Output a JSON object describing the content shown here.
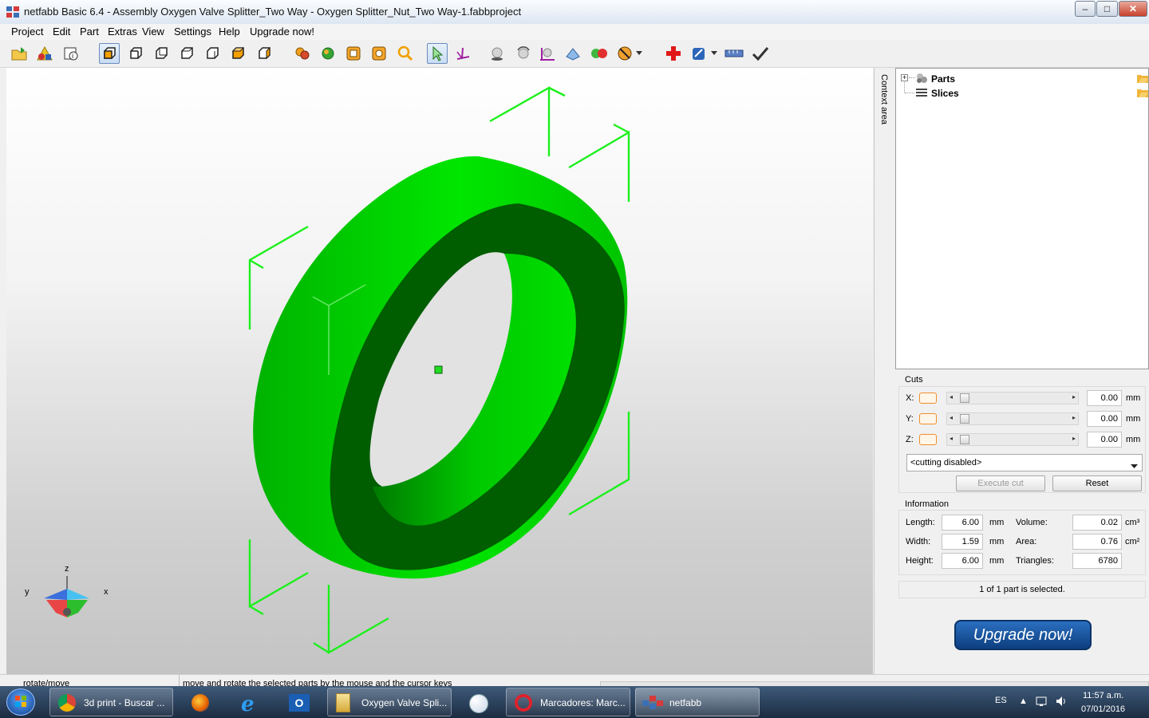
{
  "window": {
    "title": "netfabb Basic 6.4 - Assembly Oxygen Valve Splitter_Two Way - Oxygen Splitter_Nut_Two Way-1.fabbproject",
    "controls": [
      "–",
      "□",
      "✕"
    ]
  },
  "menu": [
    "Project",
    "Edit",
    "Part",
    "Extras",
    "View",
    "Settings",
    "Help",
    "Upgrade now!"
  ],
  "context_area_label": "Context area",
  "tree": {
    "parts": "Parts",
    "slices": "Slices"
  },
  "axis_labels": {
    "z": "z",
    "y": "y",
    "x": "x"
  },
  "cuts": {
    "title": "Cuts",
    "rows": [
      {
        "axis": "X:",
        "value": "0.00",
        "unit": "mm"
      },
      {
        "axis": "Y:",
        "value": "0.00",
        "unit": "mm"
      },
      {
        "axis": "Z:",
        "value": "0.00",
        "unit": "mm"
      }
    ],
    "mode": "<cutting disabled>",
    "execute_label": "Execute cut",
    "reset_label": "Reset"
  },
  "information": {
    "title": "Information",
    "length_label": "Length:",
    "length_value": "6.00",
    "length_unit": "mm",
    "width_label": "Width:",
    "width_value": "1.59",
    "width_unit": "mm",
    "height_label": "Height:",
    "height_value": "6.00",
    "height_unit": "mm",
    "volume_label": "Volume:",
    "volume_value": "0.02",
    "volume_unit": "cm³",
    "area_label": "Area:",
    "area_value": "0.76",
    "area_unit": "cm²",
    "triangles_label": "Triangles:",
    "triangles_value": "6780"
  },
  "selection_status": "1 of 1 part is selected.",
  "upgrade_button": "Upgrade now!",
  "statusbar": {
    "left": "rotate/move",
    "hint": "move and rotate the selected parts by the mouse and the cursor keys"
  },
  "taskbar": {
    "items": [
      {
        "label": "3d print - Buscar ..."
      },
      {
        "label": "Oxygen Valve Spli..."
      },
      {
        "label": "Marcadores: Marc..."
      },
      {
        "label": "netfabb"
      }
    ],
    "language": "ES",
    "time": "11:57 a.m.",
    "date": "07/01/2016"
  },
  "colors": {
    "part": "#00dd00",
    "part_dark": "#005c00",
    "bbox": "#22ee22",
    "upgrade": "#0d3f7f",
    "cut_swatch": "#f08f2a"
  }
}
